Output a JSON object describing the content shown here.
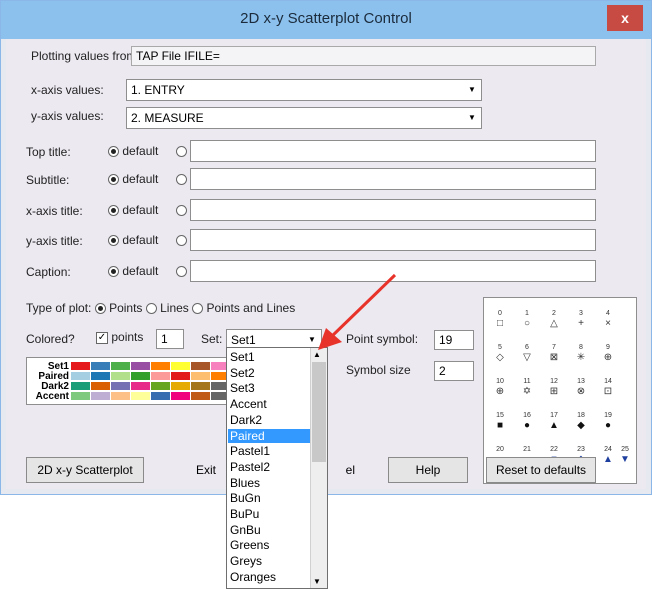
{
  "window": {
    "title": "2D x-y Scatterplot Control",
    "close_label": "x"
  },
  "plotting": {
    "label": "Plotting values from:",
    "value": "TAP File IFILE="
  },
  "x_axis_values": {
    "label": "x-axis values:",
    "value": "1. ENTRY"
  },
  "y_axis_values": {
    "label": "y-axis values:",
    "value": "2. MEASURE"
  },
  "title_rows": [
    {
      "label": "Top title:",
      "default_label": "default"
    },
    {
      "label": "Subtitle:",
      "default_label": "default"
    },
    {
      "label": "x-axis title:",
      "default_label": "default"
    },
    {
      "label": "y-axis title:",
      "default_label": "default"
    },
    {
      "label": "Caption:",
      "default_label": "default"
    }
  ],
  "plot_type": {
    "label": "Type of plot:",
    "options": [
      "Points",
      "Lines",
      "Points and Lines"
    ],
    "selected": "Points"
  },
  "colored": {
    "label": "Colored?",
    "checkbox_label": "points",
    "checked": true,
    "value": "1"
  },
  "set": {
    "label": "Set:",
    "value": "Set1"
  },
  "point_symbol": {
    "label": "Point symbol:",
    "value": "19"
  },
  "symbol_size": {
    "label": "Symbol size",
    "value": "2"
  },
  "palettes": [
    {
      "name": "Set1",
      "colors": [
        "#e41a1c",
        "#377eb8",
        "#4daf4a",
        "#984ea3",
        "#ff7f00",
        "#ffff33",
        "#a65628",
        "#f781bf"
      ]
    },
    {
      "name": "Paired",
      "colors": [
        "#a6cee3",
        "#1f78b4",
        "#b2df8a",
        "#33a02c",
        "#fb9a99",
        "#e31a1c",
        "#fdbf6f",
        "#ff7f00"
      ]
    },
    {
      "name": "Dark2",
      "colors": [
        "#1b9e77",
        "#d95f02",
        "#7570b3",
        "#e7298a",
        "#66a61e",
        "#e6ab02",
        "#a6761d",
        "#666666"
      ]
    },
    {
      "name": "Accent",
      "colors": [
        "#7fc97f",
        "#beaed4",
        "#fdc086",
        "#ffff99",
        "#386cb0",
        "#f0027f",
        "#bf5b17",
        "#666666"
      ]
    }
  ],
  "set_options": [
    "Set1",
    "Set2",
    "Set3",
    "Accent",
    "Dark2",
    "Paired",
    "Pastel1",
    "Pastel2",
    "Blues",
    "BuGn",
    "BuPu",
    "GnBu",
    "Greens",
    "Greys",
    "Oranges"
  ],
  "set_selected": "Paired",
  "symbols": [
    {
      "num": "0",
      "glyph": "□",
      "color": "#333333"
    },
    {
      "num": "1",
      "glyph": "○",
      "color": "#333333"
    },
    {
      "num": "2",
      "glyph": "△",
      "color": "#333333"
    },
    {
      "num": "3",
      "glyph": "+",
      "color": "#333333"
    },
    {
      "num": "4",
      "glyph": "×",
      "color": "#333333"
    },
    {
      "num": "5",
      "glyph": "◇",
      "color": "#333333"
    },
    {
      "num": "6",
      "glyph": "▽",
      "color": "#333333"
    },
    {
      "num": "7",
      "glyph": "⊠",
      "color": "#333333"
    },
    {
      "num": "8",
      "glyph": "✳",
      "color": "#333333"
    },
    {
      "num": "9",
      "glyph": "⊕",
      "color": "#333333"
    },
    {
      "num": "10",
      "glyph": "⊕",
      "color": "#333333"
    },
    {
      "num": "11",
      "glyph": "✡",
      "color": "#333333"
    },
    {
      "num": "12",
      "glyph": "⊞",
      "color": "#333333"
    },
    {
      "num": "13",
      "glyph": "⊗",
      "color": "#333333"
    },
    {
      "num": "14",
      "glyph": "⊡",
      "color": "#333333"
    },
    {
      "num": "15",
      "glyph": "■",
      "color": "#111111"
    },
    {
      "num": "16",
      "glyph": "●",
      "color": "#111111"
    },
    {
      "num": "17",
      "glyph": "▲",
      "color": "#111111"
    },
    {
      "num": "18",
      "glyph": "◆",
      "color": "#111111"
    },
    {
      "num": "19",
      "glyph": "●",
      "color": "#111111"
    },
    {
      "num": "20",
      "glyph": "•",
      "color": "#111111"
    },
    {
      "num": "21",
      "glyph": "●",
      "color": "#1f3f9f"
    },
    {
      "num": "22",
      "glyph": "■",
      "color": "#1f3f9f"
    },
    {
      "num": "23",
      "glyph": "◆",
      "color": "#1f3f9f"
    },
    {
      "num": "24",
      "glyph": "▲",
      "color": "#1f3f9f"
    },
    {
      "num": "25",
      "glyph": "▼",
      "color": "#1f3f9f"
    }
  ],
  "buttons": {
    "scatterplot": "2D x-y Scatterplot",
    "exit": "Exit",
    "cancel": "el",
    "help": "Help",
    "reset": "Reset to defaults"
  },
  "colors": {
    "titlebar": "#8cc1ee",
    "close": "#c74a43",
    "selection": "#3399ff",
    "arrow": "#e8332a"
  }
}
